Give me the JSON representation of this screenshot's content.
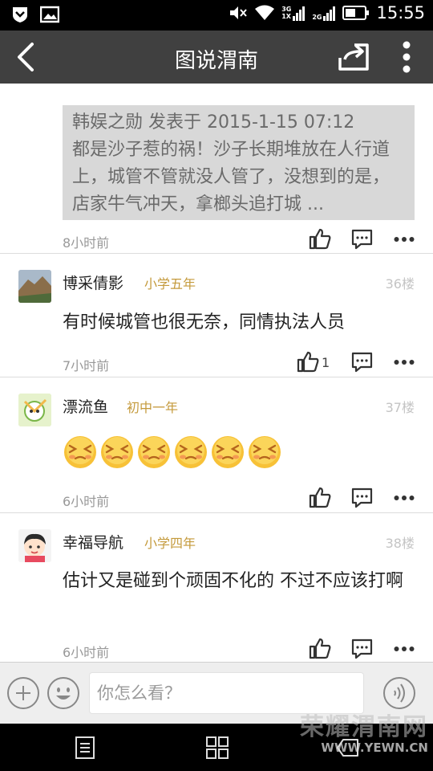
{
  "status_bar": {
    "time": "15:55",
    "network_3g": "3G",
    "network_1x": "1X",
    "network_2g": "2G"
  },
  "header": {
    "title": "图说渭南"
  },
  "quoted_comment": {
    "author": "韩娱之勋",
    "action": "发表于",
    "datetime": "2015-1-15 07:12",
    "text": "都是沙子惹的祸！沙子长期堆放在人行道上，城管不管就没人管了，没想到的是，店家牛气冲天，拿榔头追打城 ...",
    "time_ago": "8小时前"
  },
  "comments": [
    {
      "username": "博采倩影",
      "grade": "小学五年",
      "floor": "36楼",
      "text": "有时候城管也很无奈，同情执法人员",
      "time_ago": "7小时前",
      "like_count": "1"
    },
    {
      "username": "漂流鱼",
      "grade": "初中一年",
      "floor": "37楼",
      "emoji_count": 6,
      "time_ago": "6小时前"
    },
    {
      "username": "幸福导航",
      "grade": "小学四年",
      "floor": "38楼",
      "text": "估计又是碰到个顽固不化的 不过不应该打啊",
      "time_ago": "6小时前"
    }
  ],
  "input_bar": {
    "placeholder": "你怎么看？"
  },
  "watermark": {
    "cn": "荣耀渭南网",
    "en": "WWW.YEWN.CN"
  },
  "colors": {
    "title_bar": "#404040",
    "grade": "#c49a3c",
    "quote_bg": "#d8d8d8"
  }
}
